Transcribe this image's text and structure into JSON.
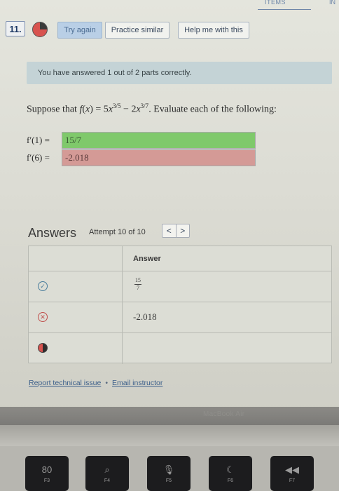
{
  "header": {
    "items_label": "ITEMS",
    "corner_label": "IN"
  },
  "question": {
    "number": "11.",
    "buttons": {
      "try_again": "Try again",
      "practice_similar": "Practice similar",
      "help_me": "Help me with this"
    },
    "banner": "You have answered 1 out of 2 parts correctly.",
    "prompt": {
      "lead": "Suppose that ",
      "fn": "f",
      "var": "x",
      "eq": " = 5",
      "exp1": "3/5",
      "minus": " − 2",
      "exp2": "3/7",
      "tail": ". Evaluate each of the following:"
    },
    "parts": [
      {
        "label": "f′(1) =",
        "value": "15/7",
        "status": "correct"
      },
      {
        "label": "f′(6) =",
        "value": "-2.018",
        "status": "incorrect"
      }
    ]
  },
  "answers": {
    "title": "Answers",
    "attempt": "Attempt 10 of 10",
    "nav_prev": "<",
    "nav_next": ">",
    "column_header": "Answer",
    "rows": [
      {
        "status": "correct",
        "numerator": "15",
        "denominator": "7"
      },
      {
        "status": "incorrect",
        "value": "-2.018"
      },
      {
        "status": "pending",
        "value": ""
      }
    ]
  },
  "links": {
    "report": "Report technical issue",
    "separator": "•",
    "email": "Email instructor"
  },
  "laptop": {
    "bezel_text": "MacBook Air",
    "keys": [
      {
        "icon": "80",
        "label": "F3"
      },
      {
        "icon": "⌕",
        "label": "F4"
      },
      {
        "icon": "🎙",
        "label": "F5"
      },
      {
        "icon": "☾",
        "label": "F6"
      },
      {
        "icon": "◀◀",
        "label": "F7"
      }
    ]
  },
  "colors": {
    "correct_fill": "#7fc96b",
    "incorrect_fill": "#d49a96",
    "banner": "#c4d3d6",
    "link": "#3c5f8a"
  }
}
